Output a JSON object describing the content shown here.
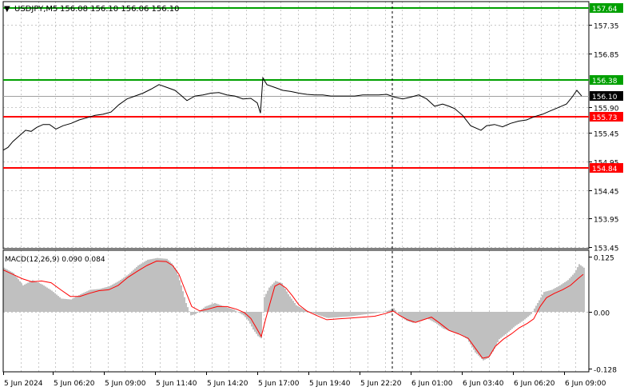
{
  "header": {
    "arrow": "▼",
    "symbol": "USDJPY,M5",
    "ohlc": "156.08 156.10 156.06 156.10"
  },
  "colors": {
    "background": "#ffffff",
    "grid": "#c8c8c8",
    "price": "#000000",
    "resistance": "#00a000",
    "support": "#ff0000",
    "current": "#000000",
    "histogram": "#c0c0c0",
    "signal": "#ff0000"
  },
  "chart_data": [
    {
      "type": "line",
      "title": "",
      "x": [
        "5 Jun 2024",
        "5 Jun 06:20",
        "5 Jun 09:00",
        "5 Jun 11:40",
        "5 Jun 14:20",
        "5 Jun 17:00",
        "5 Jun 19:40",
        "5 Jun 22:20",
        "6 Jun 01:00",
        "6 Jun 03:40",
        "6 Jun 06:20",
        "6 Jun 09:00"
      ],
      "y_ticks": [
        "157.35",
        "156.85",
        "155.90",
        "155.45",
        "154.95",
        "154.45",
        "153.95",
        "153.45"
      ],
      "ylim": [
        153.4,
        157.7
      ],
      "grid": true,
      "levels": [
        {
          "label": "157.64",
          "value": 157.64,
          "color": "#00a000"
        },
        {
          "label": "156.38",
          "value": 156.38,
          "color": "#00a000"
        },
        {
          "label": "155.73",
          "value": 155.73,
          "color": "#ff0000"
        },
        {
          "label": "154.84",
          "value": 154.84,
          "color": "#ff0000"
        }
      ],
      "current_price": {
        "label": "156.10",
        "value": 156.1
      },
      "series": [
        {
          "values": [
            [
              0,
              155.15
            ],
            [
              6,
              155.2
            ],
            [
              12,
              155.3
            ],
            [
              20,
              155.4
            ],
            [
              28,
              155.5
            ],
            [
              35,
              155.48
            ],
            [
              42,
              155.55
            ],
            [
              50,
              155.6
            ],
            [
              58,
              155.6
            ],
            [
              66,
              155.52
            ],
            [
              75,
              155.58
            ],
            [
              85,
              155.62
            ],
            [
              95,
              155.68
            ],
            [
              105,
              155.72
            ],
            [
              115,
              155.76
            ],
            [
              125,
              155.78
            ],
            [
              135,
              155.82
            ],
            [
              145,
              155.95
            ],
            [
              155,
              156.05
            ],
            [
              165,
              156.1
            ],
            [
              175,
              156.15
            ],
            [
              185,
              156.22
            ],
            [
              195,
              156.3
            ],
            [
              205,
              156.25
            ],
            [
              215,
              156.2
            ],
            [
              222,
              156.12
            ],
            [
              230,
              156.02
            ],
            [
              240,
              156.1
            ],
            [
              250,
              156.12
            ],
            [
              260,
              156.15
            ],
            [
              270,
              156.16
            ],
            [
              280,
              156.12
            ],
            [
              290,
              156.1
            ],
            [
              300,
              156.05
            ],
            [
              310,
              156.06
            ],
            [
              318,
              155.98
            ],
            [
              322,
              155.8
            ],
            [
              325,
              156.42
            ],
            [
              330,
              156.3
            ],
            [
              340,
              156.25
            ],
            [
              350,
              156.2
            ],
            [
              360,
              156.18
            ],
            [
              370,
              156.15
            ],
            [
              380,
              156.13
            ],
            [
              390,
              156.12
            ],
            [
              400,
              156.12
            ],
            [
              410,
              156.1
            ],
            [
              420,
              156.1
            ],
            [
              430,
              156.1
            ],
            [
              440,
              156.1
            ],
            [
              450,
              156.12
            ],
            [
              460,
              156.12
            ],
            [
              470,
              156.12
            ],
            [
              480,
              156.13
            ],
            [
              490,
              156.08
            ],
            [
              500,
              156.05
            ],
            [
              510,
              156.08
            ],
            [
              520,
              156.12
            ],
            [
              530,
              156.05
            ],
            [
              540,
              155.92
            ],
            [
              550,
              155.96
            ],
            [
              558,
              155.92
            ],
            [
              565,
              155.88
            ],
            [
              575,
              155.76
            ],
            [
              585,
              155.58
            ],
            [
              598,
              155.5
            ],
            [
              605,
              155.58
            ],
            [
              615,
              155.6
            ],
            [
              625,
              155.56
            ],
            [
              635,
              155.62
            ],
            [
              645,
              155.66
            ],
            [
              655,
              155.68
            ],
            [
              665,
              155.74
            ],
            [
              675,
              155.78
            ],
            [
              685,
              155.84
            ],
            [
              695,
              155.9
            ],
            [
              705,
              155.96
            ],
            [
              712,
              156.08
            ],
            [
              718,
              156.2
            ],
            [
              724,
              156.1
            ]
          ]
        }
      ]
    },
    {
      "type": "bar",
      "title": "MACD(12,26,9) 0.090 0.084",
      "y_ticks": [
        "0.125",
        "0.00",
        "-0.128"
      ],
      "ylim": [
        -0.135,
        0.135
      ],
      "series": [
        {
          "name": "MACD",
          "kind": "histogram",
          "values": [
            [
              0,
              0.1
            ],
            [
              12,
              0.088
            ],
            [
              24,
              0.06
            ],
            [
              36,
              0.072
            ],
            [
              48,
              0.062
            ],
            [
              60,
              0.048
            ],
            [
              72,
              0.03
            ],
            [
              84,
              0.028
            ],
            [
              96,
              0.04
            ],
            [
              108,
              0.05
            ],
            [
              120,
              0.052
            ],
            [
              132,
              0.058
            ],
            [
              144,
              0.07
            ],
            [
              156,
              0.085
            ],
            [
              168,
              0.105
            ],
            [
              180,
              0.118
            ],
            [
              192,
              0.122
            ],
            [
              204,
              0.12
            ],
            [
              210,
              0.11
            ],
            [
              216,
              0.095
            ],
            [
              222,
              0.06
            ],
            [
              228,
              0.02
            ],
            [
              234,
              -0.008
            ],
            [
              240,
              -0.005
            ],
            [
              252,
              0.012
            ],
            [
              264,
              0.02
            ],
            [
              276,
              0.012
            ],
            [
              288,
              0.005
            ],
            [
              300,
              -0.008
            ],
            [
              306,
              -0.02
            ],
            [
              312,
              -0.04
            ],
            [
              318,
              -0.055
            ],
            [
              322,
              -0.06
            ],
            [
              325,
              0.03
            ],
            [
              332,
              0.055
            ],
            [
              340,
              0.07
            ],
            [
              348,
              0.065
            ],
            [
              356,
              0.04
            ],
            [
              366,
              0.015
            ],
            [
              376,
              0.005
            ],
            [
              390,
              -0.005
            ],
            [
              405,
              -0.014
            ],
            [
              420,
              -0.012
            ],
            [
              435,
              -0.01
            ],
            [
              450,
              -0.006
            ],
            [
              465,
              -0.003
            ],
            [
              480,
              0.002
            ],
            [
              488,
              0.008
            ],
            [
              496,
              -0.01
            ],
            [
              504,
              -0.02
            ],
            [
              512,
              -0.025
            ],
            [
              520,
              -0.022
            ],
            [
              530,
              -0.015
            ],
            [
              540,
              -0.025
            ],
            [
              550,
              -0.038
            ],
            [
              560,
              -0.045
            ],
            [
              570,
              -0.05
            ],
            [
              580,
              -0.062
            ],
            [
              590,
              -0.092
            ],
            [
              600,
              -0.11
            ],
            [
              606,
              -0.105
            ],
            [
              612,
              -0.09
            ],
            [
              620,
              -0.062
            ],
            [
              630,
              -0.048
            ],
            [
              640,
              -0.032
            ],
            [
              650,
              -0.02
            ],
            [
              660,
              -0.005
            ],
            [
              668,
              0.02
            ],
            [
              676,
              0.045
            ],
            [
              686,
              0.05
            ],
            [
              696,
              0.06
            ],
            [
              706,
              0.072
            ],
            [
              714,
              0.088
            ],
            [
              720,
              0.108
            ],
            [
              726,
              0.1
            ]
          ]
        },
        {
          "name": "Signal",
          "kind": "line",
          "values": [
            [
              0,
              0.095
            ],
            [
              12,
              0.085
            ],
            [
              24,
              0.075
            ],
            [
              36,
              0.068
            ],
            [
              48,
              0.07
            ],
            [
              60,
              0.066
            ],
            [
              72,
              0.05
            ],
            [
              84,
              0.035
            ],
            [
              96,
              0.035
            ],
            [
              108,
              0.042
            ],
            [
              120,
              0.048
            ],
            [
              132,
              0.05
            ],
            [
              144,
              0.06
            ],
            [
              156,
              0.078
            ],
            [
              168,
              0.092
            ],
            [
              180,
              0.105
            ],
            [
              192,
              0.115
            ],
            [
              204,
              0.114
            ],
            [
              212,
              0.105
            ],
            [
              220,
              0.085
            ],
            [
              228,
              0.048
            ],
            [
              236,
              0.012
            ],
            [
              246,
              0.002
            ],
            [
              256,
              0.006
            ],
            [
              268,
              0.012
            ],
            [
              280,
              0.012
            ],
            [
              292,
              0.006
            ],
            [
              302,
              -0.002
            ],
            [
              310,
              -0.015
            ],
            [
              318,
              -0.04
            ],
            [
              323,
              -0.056
            ],
            [
              328,
              -0.02
            ],
            [
              334,
              0.02
            ],
            [
              340,
              0.058
            ],
            [
              346,
              0.064
            ],
            [
              354,
              0.054
            ],
            [
              362,
              0.036
            ],
            [
              370,
              0.016
            ],
            [
              380,
              0.002
            ],
            [
              392,
              -0.008
            ],
            [
              405,
              -0.018
            ],
            [
              420,
              -0.016
            ],
            [
              435,
              -0.014
            ],
            [
              450,
              -0.012
            ],
            [
              465,
              -0.01
            ],
            [
              478,
              -0.004
            ],
            [
              488,
              0.002
            ],
            [
              496,
              -0.008
            ],
            [
              506,
              -0.018
            ],
            [
              516,
              -0.024
            ],
            [
              526,
              -0.018
            ],
            [
              536,
              -0.012
            ],
            [
              546,
              -0.025
            ],
            [
              558,
              -0.042
            ],
            [
              570,
              -0.05
            ],
            [
              582,
              -0.06
            ],
            [
              592,
              -0.085
            ],
            [
              600,
              -0.105
            ],
            [
              608,
              -0.102
            ],
            [
              616,
              -0.078
            ],
            [
              626,
              -0.062
            ],
            [
              636,
              -0.05
            ],
            [
              646,
              -0.036
            ],
            [
              656,
              -0.026
            ],
            [
              664,
              -0.016
            ],
            [
              672,
              0.012
            ],
            [
              680,
              0.032
            ],
            [
              690,
              0.042
            ],
            [
              700,
              0.05
            ],
            [
              710,
              0.06
            ],
            [
              720,
              0.076
            ],
            [
              726,
              0.085
            ]
          ]
        }
      ]
    }
  ]
}
